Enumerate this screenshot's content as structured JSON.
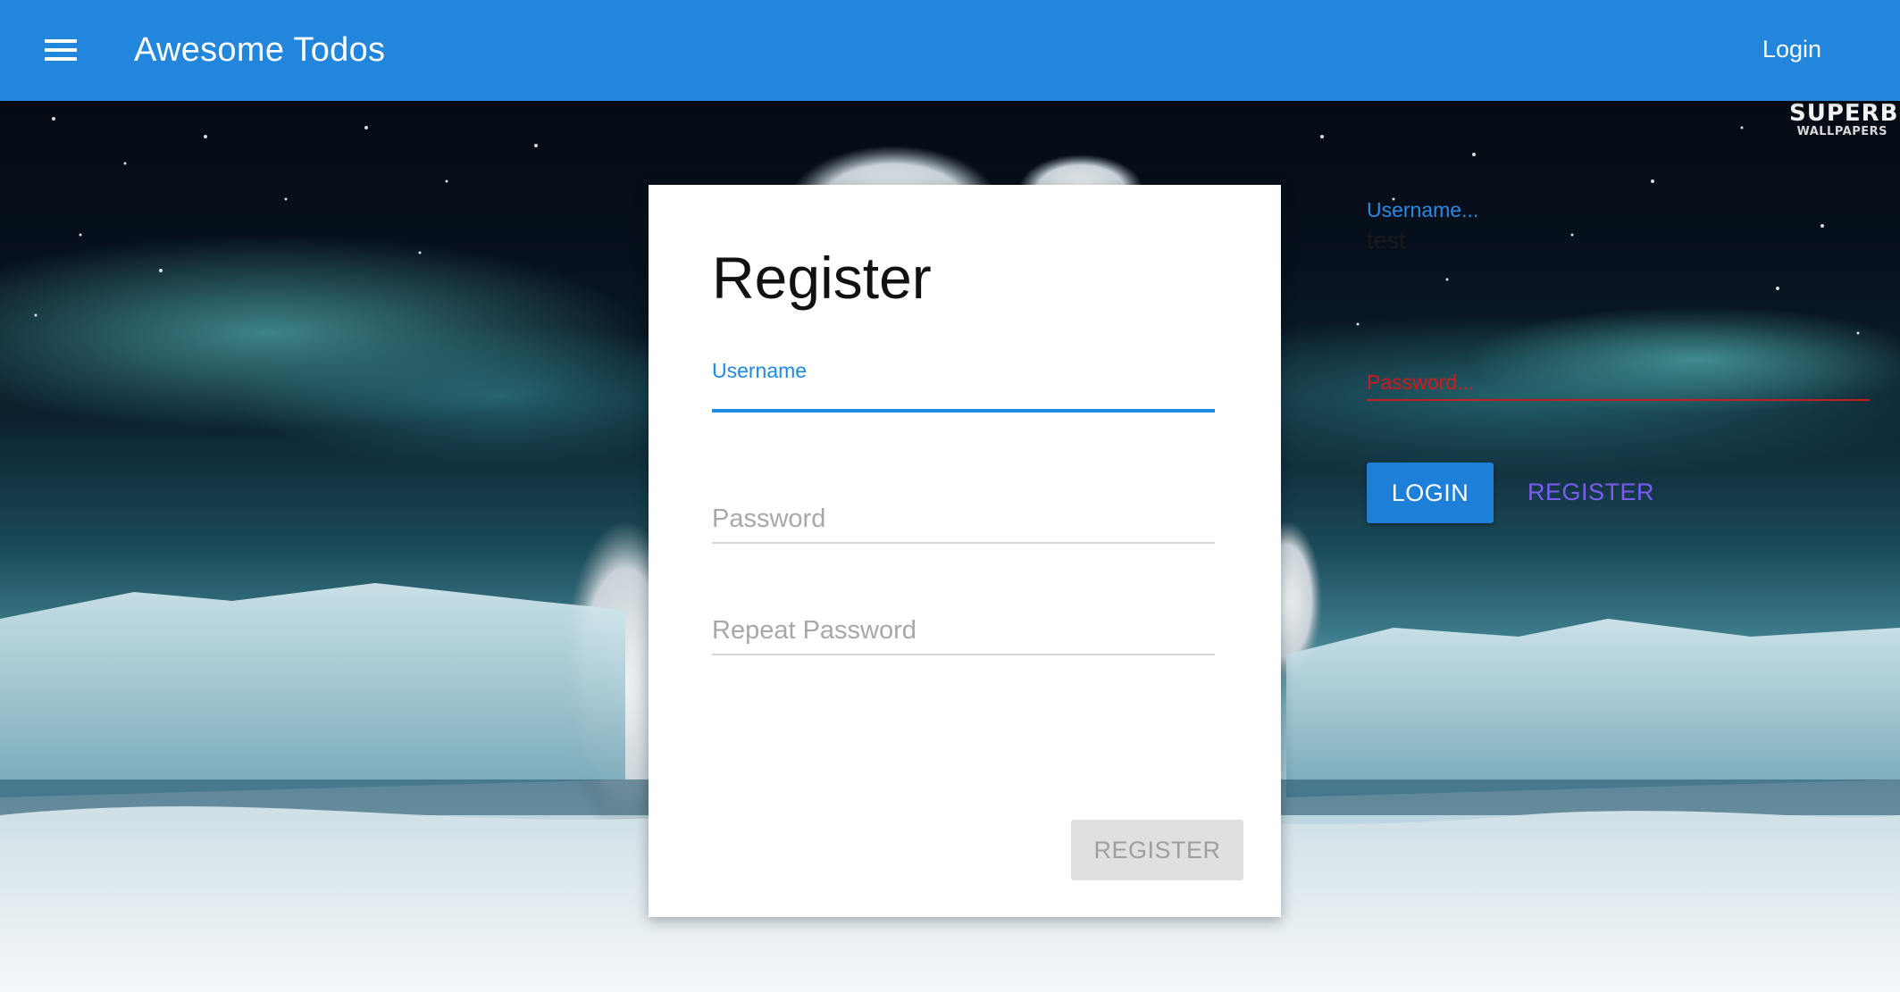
{
  "appbar": {
    "title": "Awesome Todos",
    "login_label": "Login",
    "menu_icon": "hamburger-menu-icon",
    "color": "#2286dc"
  },
  "watermark": {
    "line1": "SUPERB",
    "line2": "WALLPAPERS"
  },
  "register_card": {
    "title": "Register",
    "username_label": "Username",
    "username_value": "",
    "password_placeholder": "Password",
    "repeat_password_placeholder": "Repeat Password",
    "submit_label": "REGISTER",
    "submit_enabled": false,
    "accent": "#1e88e5"
  },
  "side_login": {
    "username_label": "Username...",
    "username_value": "test",
    "password_label": "Password...",
    "password_error_color": "#d11a1a",
    "login_label": "LOGIN",
    "register_label": "REGISTER",
    "register_link_color": "#7b5cf5"
  }
}
